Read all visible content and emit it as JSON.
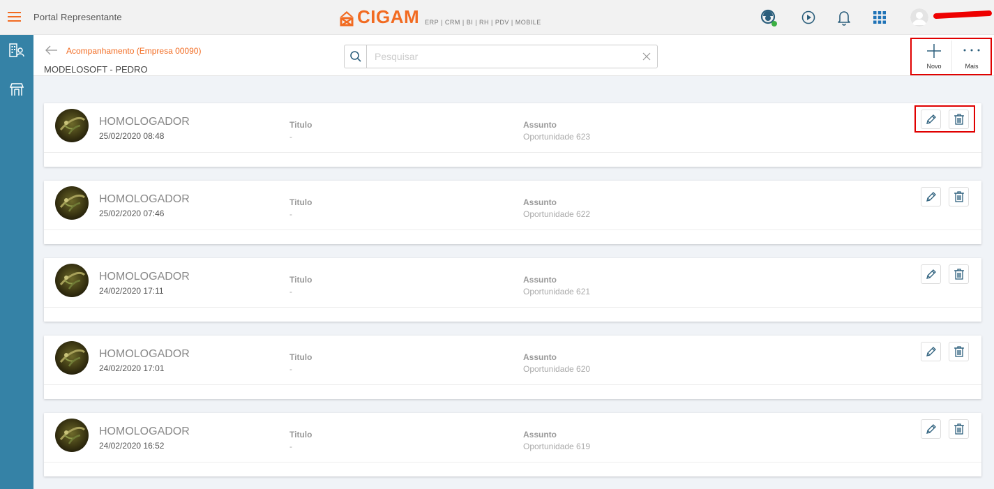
{
  "header": {
    "portal_title": "Portal Representante",
    "logo_text": "CIGAM",
    "logo_subtitle": "ERP | CRM | BI | RH | PDV | MOBILE",
    "brand_color": "#f26b21",
    "icons": [
      "support-agent-icon",
      "play-icon",
      "bell-icon",
      "apps-grid-icon",
      "user-avatar"
    ]
  },
  "sidebar": {
    "color": "#3582a6",
    "items": [
      {
        "icon": "company-contacts-icon"
      },
      {
        "icon": "store-icon"
      }
    ]
  },
  "subheader": {
    "breadcrumb": "Acompanhamento (Empresa 00090)",
    "title": "MODELOSOFT - PEDRO",
    "search_placeholder": "Pesquisar",
    "search_value": "",
    "actions": {
      "new_label": "Novo",
      "more_label": "Mais"
    }
  },
  "columns": {
    "title_label": "Titulo",
    "subject_label": "Assunto"
  },
  "records": [
    {
      "author": "HOMOLOGADOR",
      "date": "25/02/2020 08:48",
      "title": "-",
      "subject": "Oportunidade 623"
    },
    {
      "author": "HOMOLOGADOR",
      "date": "25/02/2020 07:46",
      "title": "-",
      "subject": "Oportunidade 622"
    },
    {
      "author": "HOMOLOGADOR",
      "date": "24/02/2020 17:11",
      "title": "-",
      "subject": "Oportunidade 621"
    },
    {
      "author": "HOMOLOGADOR",
      "date": "24/02/2020 17:01",
      "title": "-",
      "subject": "Oportunidade 620"
    },
    {
      "author": "HOMOLOGADOR",
      "date": "24/02/2020 16:52",
      "title": "-",
      "subject": "Oportunidade 619"
    }
  ]
}
